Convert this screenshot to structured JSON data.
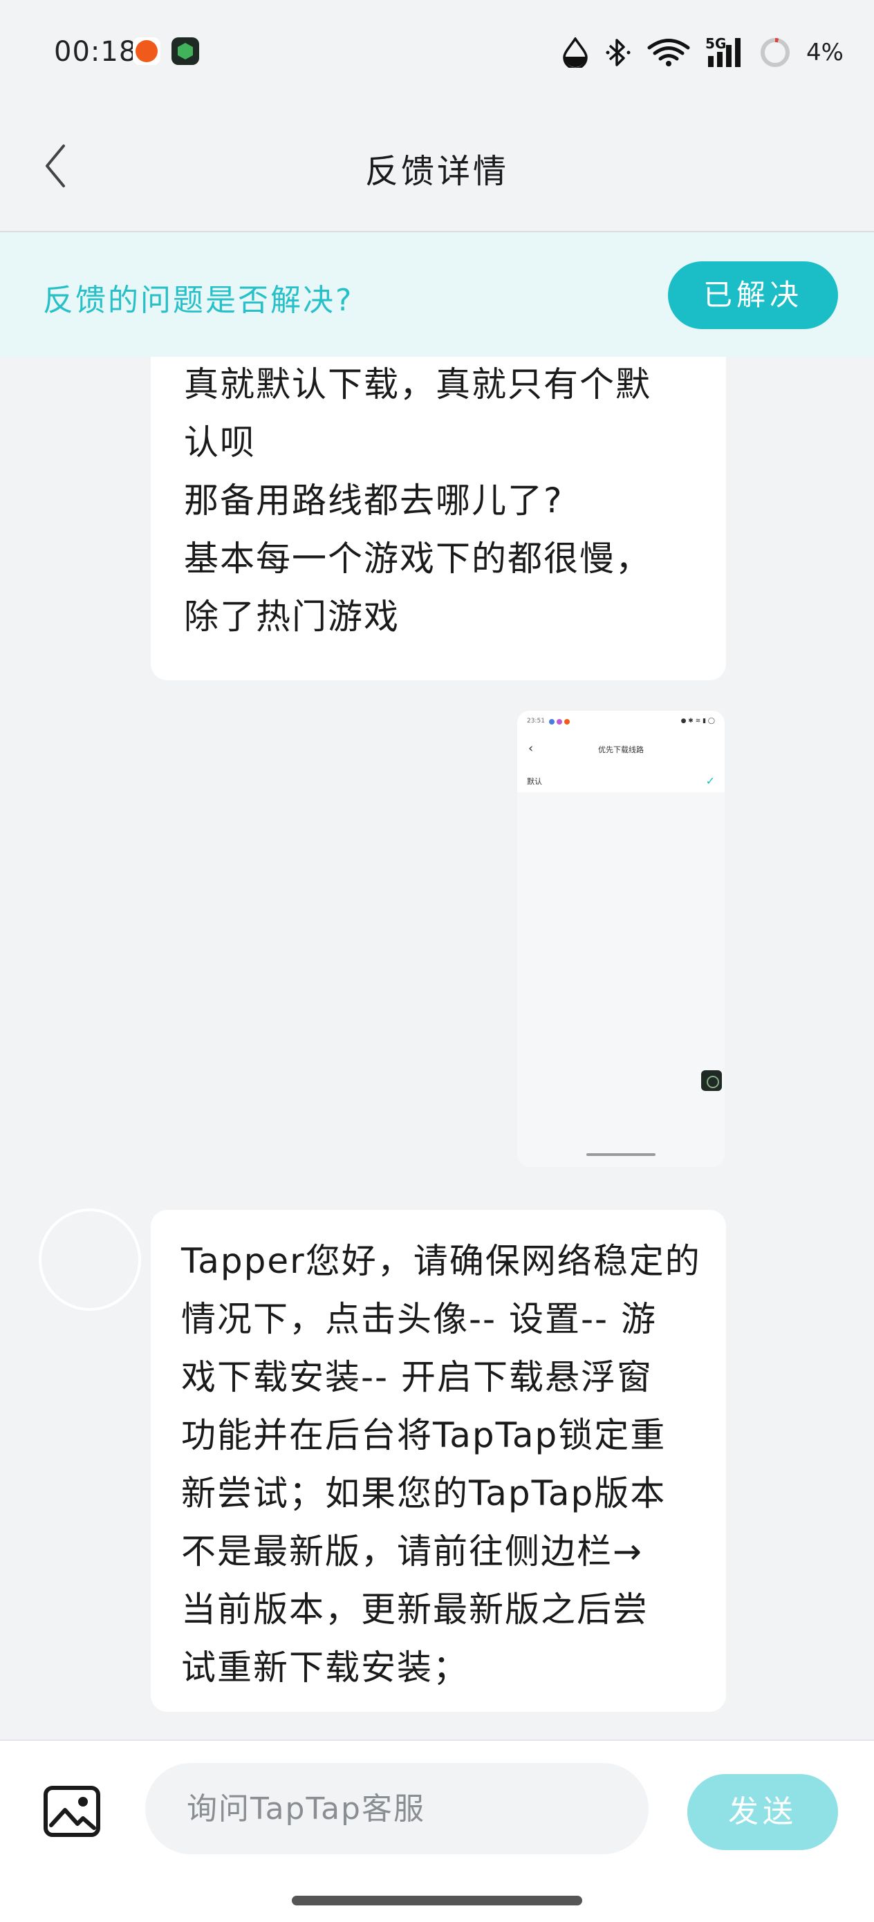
{
  "status_bar": {
    "time": "00:18",
    "battery": "4%",
    "network": "5G"
  },
  "header": {
    "title": "反馈详情"
  },
  "banner": {
    "question": "反馈的问题是否解决?",
    "resolved_label": "已解决",
    "accent_color": "#1bbec7"
  },
  "messages": {
    "user_text_lines": [
      "真就默认下载，真就只有个默",
      "认呗",
      "那备用路线都去哪儿了?",
      "基本每一个游戏下的都很慢，",
      "除了热门游戏"
    ],
    "screenshot": {
      "title": "优先下载线路",
      "item": "默认"
    },
    "agent_text_lines": [
      "Tapper您好，请确保网络稳定的",
      "情况下，点击头像-- 设置-- 游",
      "戏下载安装-- 开启下载悬浮窗",
      "功能并在后台将TapTap锁定重",
      "新尝试；如果您的TapTap版本",
      "不是最新版，请前往侧边栏→",
      "当前版本，更新最新版之后尝",
      "试重新下载安装；"
    ]
  },
  "input_bar": {
    "placeholder": "询问TapTap客服",
    "send_label": "发送"
  }
}
